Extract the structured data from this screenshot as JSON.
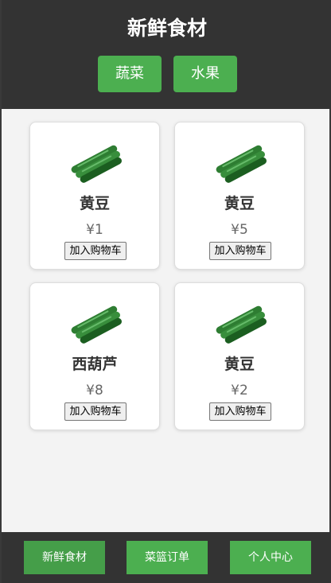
{
  "header": {
    "title": "新鲜食材",
    "categories": [
      "蔬菜",
      "水果"
    ]
  },
  "products": [
    {
      "name": "黄豆",
      "price": "¥1",
      "button": "加入购物车",
      "image": "cucumber-image"
    },
    {
      "name": "黄豆",
      "price": "¥5",
      "button": "加入购物车",
      "image": "cucumber-image"
    },
    {
      "name": "西葫芦",
      "price": "¥8",
      "button": "加入购物车",
      "image": "cucumber-image"
    },
    {
      "name": "黄豆",
      "price": "¥2",
      "button": "加入购物车",
      "image": "cucumber-image"
    }
  ],
  "footer": {
    "tabs": [
      "新鲜食材",
      "菜篮订单",
      "个人中心"
    ],
    "active_tab": "新鲜食材"
  },
  "colors": {
    "header_bg": "#333333",
    "accent": "#4caf50",
    "page_bg": "#f3f3f3"
  }
}
